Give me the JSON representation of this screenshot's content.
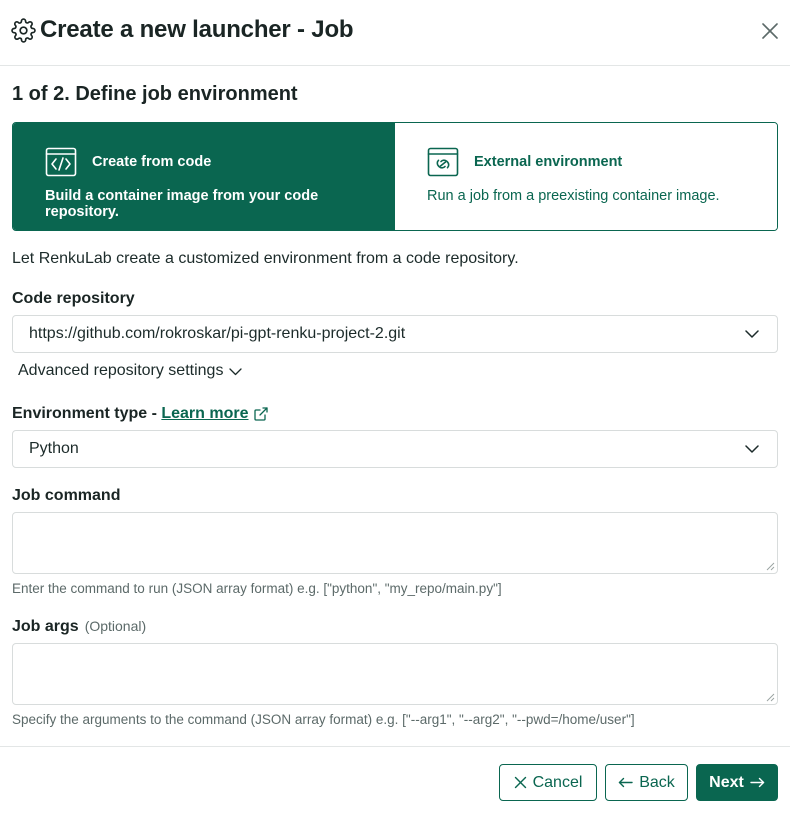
{
  "dialog": {
    "title": "Create a new launcher - Job",
    "step_title": "1 of 2. Define job environment"
  },
  "cards": [
    {
      "title": "Create from code",
      "description": "Build a container image from your code repository.",
      "selected": true,
      "icon": "code-box-icon"
    },
    {
      "title": "External environment",
      "description": "Run a job from a preexisting container image.",
      "selected": false,
      "icon": "external-link-box-icon"
    }
  ],
  "intro": "Let RenkuLab create a customized environment from a code repository.",
  "code_repository": {
    "label": "Code repository",
    "value": "https://github.com/rokroskar/pi-gpt-renku-project-2.git",
    "advanced_label": "Advanced repository settings"
  },
  "environment_type": {
    "label": "Environment type - ",
    "link_label": "Learn more",
    "value": "Python"
  },
  "job_command": {
    "label": "Job command",
    "value": "",
    "help": "Enter the command to run (JSON array format) e.g. [\"python\", \"my_repo/main.py\"]"
  },
  "job_args": {
    "label": "Job args",
    "optional": "(Optional)",
    "value": "",
    "help": "Specify the arguments to the command (JSON array format) e.g. [\"--arg1\", \"--arg2\", \"--pwd=/home/user\"]"
  },
  "footer": {
    "cancel_label": "Cancel",
    "back_label": "Back",
    "next_label": "Next"
  },
  "colors": {
    "accent": "#0a6650",
    "text": "#1c2b2a",
    "muted": "#5c6a69",
    "border": "#d8dcdc"
  }
}
